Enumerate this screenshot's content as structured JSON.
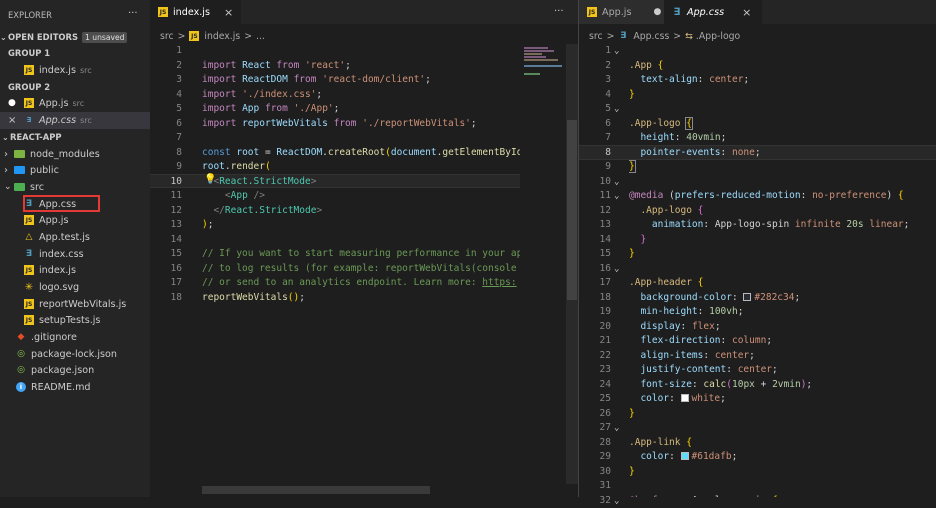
{
  "explorer": {
    "title": "EXPLORER",
    "more": "···",
    "open_editors": "OPEN EDITORS",
    "unsaved": "1 unsaved",
    "group1": "GROUP 1",
    "group2": "GROUP 2",
    "g1_file": "index.js",
    "g1_dir": "src",
    "g2_file1": "App.js",
    "g2_dir1": "src",
    "g2_file2": "App.css",
    "g2_dir2": "src",
    "project": "REACT-APP",
    "tree": [
      "node_modules",
      "public",
      "src",
      "App.css",
      "App.js",
      "App.test.js",
      "index.css",
      "index.js",
      "logo.svg",
      "reportWebVitals.js",
      "setupTests.js",
      ".gitignore",
      "package-lock.json",
      "package.json",
      "README.md"
    ]
  },
  "left_editor": {
    "tab": "index.js",
    "close": "×",
    "more": "···",
    "breadcrumb_dir": "src",
    "breadcrumb_file": "index.js",
    "breadcrumb_rest": "...",
    "sep": ">",
    "lines": [
      {
        "n": "1",
        "t": "import React from 'react';"
      },
      {
        "n": "2",
        "t": "import ReactDOM from 'react-dom/client';"
      },
      {
        "n": "3",
        "t": "import './index.css';"
      },
      {
        "n": "4",
        "t": "import App from './App';"
      },
      {
        "n": "5",
        "t": "import reportWebVitals from './reportWebVitals';"
      },
      {
        "n": "6",
        "t": ""
      },
      {
        "n": "7",
        "t": "const root = ReactDOM.createRoot(document.getElementById("
      },
      {
        "n": "8",
        "t": "root.render("
      },
      {
        "n": "9",
        "t": "  <React.StrictMode>"
      },
      {
        "n": "10",
        "t": "    <App />"
      },
      {
        "n": "11",
        "t": "  </React.StrictMode>"
      },
      {
        "n": "12",
        "t": ");"
      },
      {
        "n": "13",
        "t": ""
      },
      {
        "n": "14",
        "t": "// If you want to start measuring performance in your ap"
      },
      {
        "n": "15",
        "t": "// to log results (for example: reportWebVitals(console"
      },
      {
        "n": "16",
        "t": "// or send to an analytics endpoint. Learn more: https:"
      },
      {
        "n": "17",
        "t": "reportWebVitals();"
      },
      {
        "n": "18",
        "t": ""
      }
    ]
  },
  "right_editor": {
    "tab1": "App.js",
    "tab1_dot": "●",
    "tab2": "App.css",
    "tab2_close": "×",
    "breadcrumb_dir": "src",
    "breadcrumb_file": "App.css",
    "breadcrumb_sel": ".App-logo",
    "sep": ">",
    "colors": {
      "header_bg": "#282c34",
      "text": "white",
      "link": "#61dafb"
    },
    "lines": [
      {
        "n": "1",
        "t": ".App {"
      },
      {
        "n": "2",
        "t": "  text-align: center;"
      },
      {
        "n": "3",
        "t": "}"
      },
      {
        "n": "4",
        "t": ""
      },
      {
        "n": "5",
        "t": ".App-logo {"
      },
      {
        "n": "6",
        "t": "  height: 40vmin;"
      },
      {
        "n": "7",
        "t": "  pointer-events: none;"
      },
      {
        "n": "8",
        "t": "}"
      },
      {
        "n": "9",
        "t": ""
      },
      {
        "n": "10",
        "t": "@media (prefers-reduced-motion: no-preference) {"
      },
      {
        "n": "11",
        "t": "  .App-logo {"
      },
      {
        "n": "12",
        "t": "    animation: App-logo-spin infinite 20s linear;"
      },
      {
        "n": "13",
        "t": "  }"
      },
      {
        "n": "14",
        "t": "}"
      },
      {
        "n": "15",
        "t": ""
      },
      {
        "n": "16",
        "t": ".App-header {"
      },
      {
        "n": "17",
        "t": "  background-color: #282c34;"
      },
      {
        "n": "18",
        "t": "  min-height: 100vh;"
      },
      {
        "n": "19",
        "t": "  display: flex;"
      },
      {
        "n": "20",
        "t": "  flex-direction: column;"
      },
      {
        "n": "21",
        "t": "  align-items: center;"
      },
      {
        "n": "22",
        "t": "  justify-content: center;"
      },
      {
        "n": "23",
        "t": "  font-size: calc(10px + 2vmin);"
      },
      {
        "n": "24",
        "t": "  color: white;"
      },
      {
        "n": "25",
        "t": "}"
      },
      {
        "n": "26",
        "t": ""
      },
      {
        "n": "27",
        "t": ".App-link {"
      },
      {
        "n": "28",
        "t": "  color: #61dafb;"
      },
      {
        "n": "29",
        "t": "}"
      },
      {
        "n": "30",
        "t": ""
      },
      {
        "n": "31",
        "t": "@keyframes App-logo-spin {"
      },
      {
        "n": "32",
        "t": "  from {"
      }
    ]
  }
}
